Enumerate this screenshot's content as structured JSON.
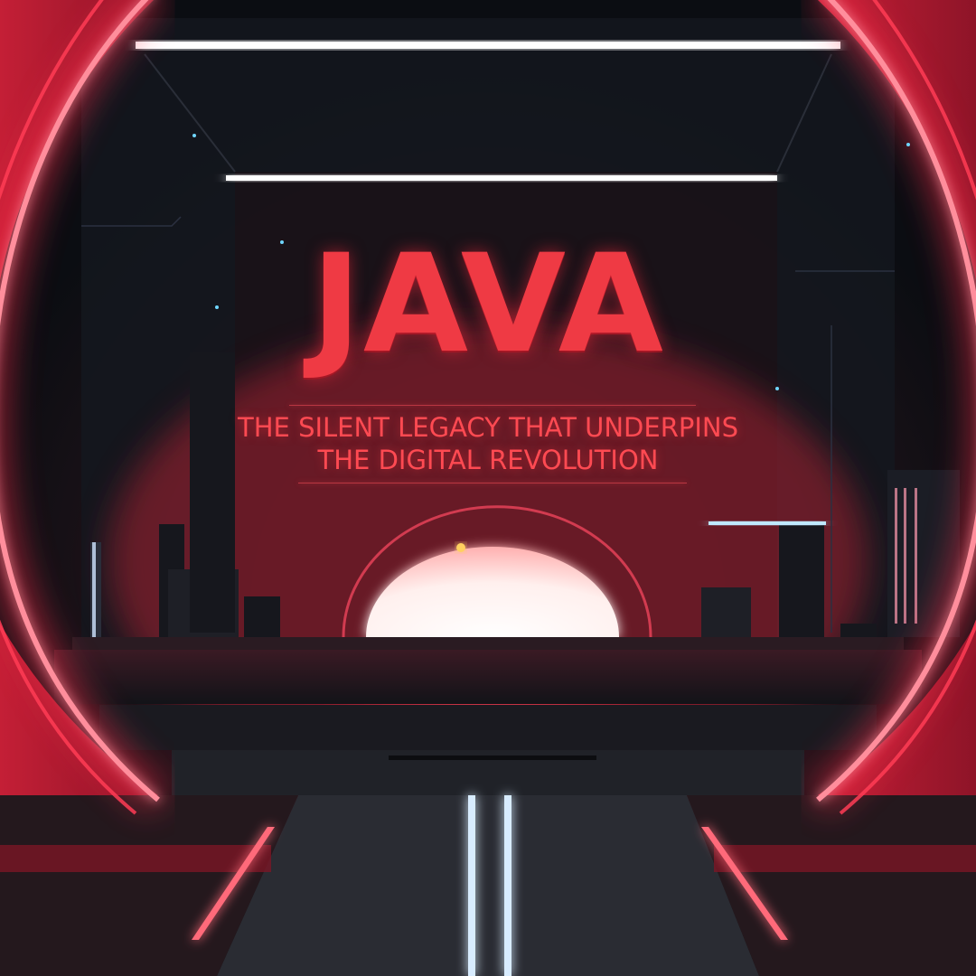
{
  "poster": {
    "title": "JAVA",
    "subtitle_line1": "THE SILENT LEGACY THAT UNDERPINS",
    "subtitle_line2": "THE DIGITAL REVOLUTION"
  },
  "colors": {
    "accent_red": "#ef3a44",
    "neon_pink": "#ff3c55",
    "background": "#0b0d12",
    "glow_white": "#fff4f2"
  },
  "icons": [
    "neon-portal-ring",
    "glowing-sun-dome",
    "city-skyline",
    "floor-light-strip"
  ]
}
